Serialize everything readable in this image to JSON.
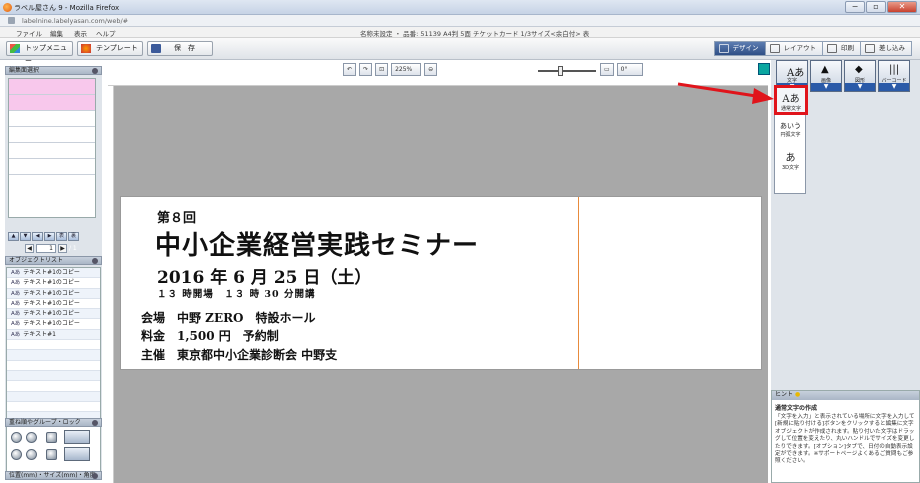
{
  "window": {
    "title": "ラベル屋さん 9 - Mozilla Firefox",
    "minimize": "−",
    "maximize": "▫",
    "close": "✕"
  },
  "url": "labelnine.labelyasan.com/web/#",
  "menu": [
    "ファイル",
    "編集",
    "表示",
    "ヘルプ"
  ],
  "doc_info": "名称未設定 ・ 品番: 51139 A4判 5面 チケットカード 1/3サイズ<余白付> 表",
  "toolbar": {
    "top_menu": "トップメニュー",
    "template": "テンプレート",
    "save": "保　存"
  },
  "modes": [
    {
      "label": "デザイン",
      "active": true
    },
    {
      "label": "レイアウト",
      "active": false
    },
    {
      "label": "印刷",
      "active": false
    },
    {
      "label": "差し込み",
      "active": false
    }
  ],
  "zoom": {
    "value": "225%",
    "angle": "0°"
  },
  "left": {
    "edit_side_header": "編集面選択",
    "nav_buttons": [
      "▲",
      "▼",
      "◀",
      "▶",
      "表",
      "裏"
    ],
    "page_current": "1",
    "page_total": "/ 1",
    "object_list_header": "オブジェクトリスト",
    "objects": [
      "テキスト#1のコピー",
      "テキスト#1のコピー",
      "テキスト#1のコピー",
      "テキスト#1のコピー",
      "テキスト#1のコピー",
      "テキスト#1のコピー",
      "テキスト#1"
    ],
    "object_glyph": "Aあ",
    "order_header": "重ね順やグループ・ロック",
    "position_header": "位置(mm)・サイズ(mm)・角度"
  },
  "label": {
    "l1": "第８回",
    "l2": "中小企業経営実践セミナー",
    "l3": "2016 年 6 月 25 日（土）",
    "l4": "１３ 時開場　１３ 時 30 分開講",
    "l5": "会場　中野 ZERO　特設ホール",
    "l6": "料金　1,500 円　予約制",
    "l7": "主催　東京都中小企業診断会 中野支"
  },
  "right": {
    "tools": [
      {
        "glyph": "Aあ",
        "label": "文字"
      },
      {
        "glyph": "▲",
        "label": "画像"
      },
      {
        "glyph": "◆",
        "label": "図形"
      },
      {
        "glyph": "|||",
        "label": "バーコード"
      }
    ],
    "text_types": [
      {
        "glyph": "Aあ",
        "label": "通常文字"
      },
      {
        "glyph": "あいう",
        "label": "円弧文字"
      },
      {
        "glyph": "あ",
        "label": "3D文字"
      }
    ],
    "dropdown_arrow": "▼"
  },
  "hint": {
    "header": "ヒント",
    "title": "通常文字の作成",
    "body": "「文字を入力」と表示されている場所に文字を入力して[新規に貼り付ける]ボタンをクリックすると編集に文字オブジェクトが作成されます。貼り付いた文字はドラッグして位置を変えたり、丸いハンドルでサイズを変更したりできます。[オプション]タブで、日付の自動表示設定ができます。※サポートページよくあるご質問もご参照ください。"
  }
}
